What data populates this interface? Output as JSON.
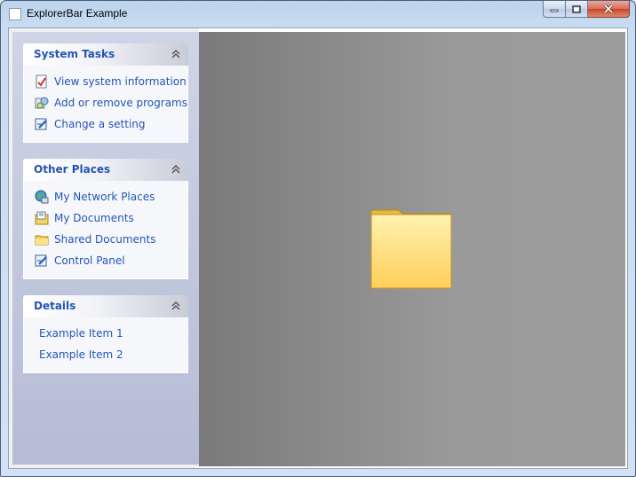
{
  "window": {
    "title": "ExplorerBar Example"
  },
  "groups": [
    {
      "title": "System Tasks",
      "items": [
        {
          "label": "View system information",
          "icon": "system-info-icon"
        },
        {
          "label": "Add or remove programs",
          "icon": "add-remove-programs-icon"
        },
        {
          "label": "Change a setting",
          "icon": "control-panel-icon"
        }
      ]
    },
    {
      "title": "Other Places",
      "items": [
        {
          "label": "My Network Places",
          "icon": "network-places-icon"
        },
        {
          "label": "My Documents",
          "icon": "my-documents-icon"
        },
        {
          "label": "Shared Documents",
          "icon": "folder-icon"
        },
        {
          "label": "Control Panel",
          "icon": "control-panel-icon"
        }
      ]
    },
    {
      "title": "Details",
      "items": [
        {
          "label": "Example Item 1"
        },
        {
          "label": "Example Item 2"
        }
      ]
    }
  ],
  "colors": {
    "link": "#2356b3",
    "viewport": "#9a9a9a",
    "folder": "#ffd86b"
  }
}
